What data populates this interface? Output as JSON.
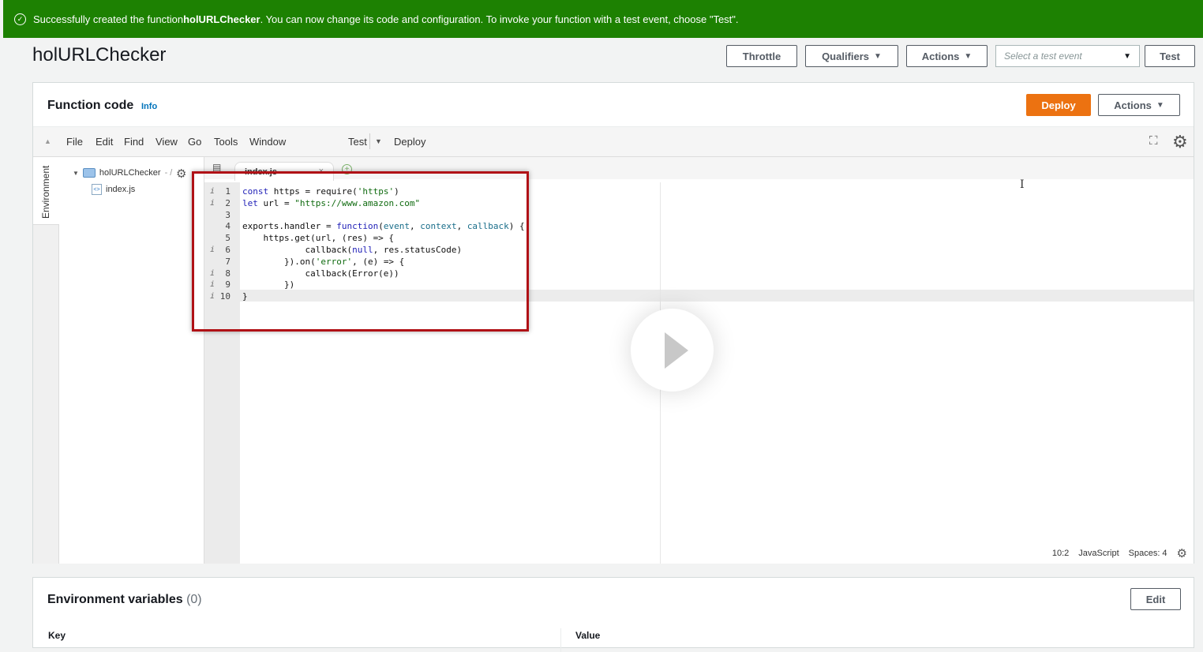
{
  "banner": {
    "prefix": "Successfully created the function ",
    "function_name": "holURLChecker",
    "suffix": ". You can now change its code and configuration. To invoke your function with a test event, choose \"Test\"."
  },
  "page": {
    "title": "holURLChecker"
  },
  "header_actions": {
    "throttle": "Throttle",
    "qualifiers": "Qualifiers",
    "actions": "Actions",
    "test_event_placeholder": "Select a test event",
    "test": "Test"
  },
  "function_code": {
    "title": "Function code",
    "info": "Info",
    "deploy": "Deploy",
    "actions": "Actions"
  },
  "ide_menu": {
    "items": [
      "File",
      "Edit",
      "Find",
      "View",
      "Go",
      "Tools",
      "Window"
    ],
    "test": "Test",
    "deploy": "Deploy"
  },
  "environment_tab": "Environment",
  "file_tree": {
    "folder": "holURLChecker",
    "folder_suffix": "- /",
    "file": "index.js"
  },
  "editor": {
    "active_tab": "index.js",
    "lines": [
      {
        "num": "1",
        "ann": "i"
      },
      {
        "num": "2",
        "ann": "i"
      },
      {
        "num": "3",
        "ann": ""
      },
      {
        "num": "4",
        "ann": ""
      },
      {
        "num": "5",
        "ann": ""
      },
      {
        "num": "6",
        "ann": "i"
      },
      {
        "num": "7",
        "ann": ""
      },
      {
        "num": "8",
        "ann": "i"
      },
      {
        "num": "9",
        "ann": "i"
      },
      {
        "num": "10",
        "ann": "i"
      }
    ],
    "code": [
      "const https = require('https')",
      "let url = \"https://www.amazon.com\"",
      "",
      "exports.handler = function(event, context, callback) {",
      "    https.get(url, (res) => {",
      "            callback(null, res.statusCode)",
      "        }).on('error', (e) => {",
      "            callback(Error(e))",
      "        })",
      "}"
    ],
    "status": {
      "position": "10:2",
      "language": "JavaScript",
      "spaces": "Spaces: 4"
    }
  },
  "env_vars": {
    "title": "Environment variables",
    "count": "(0)",
    "edit": "Edit",
    "col_key": "Key",
    "col_value": "Value"
  }
}
